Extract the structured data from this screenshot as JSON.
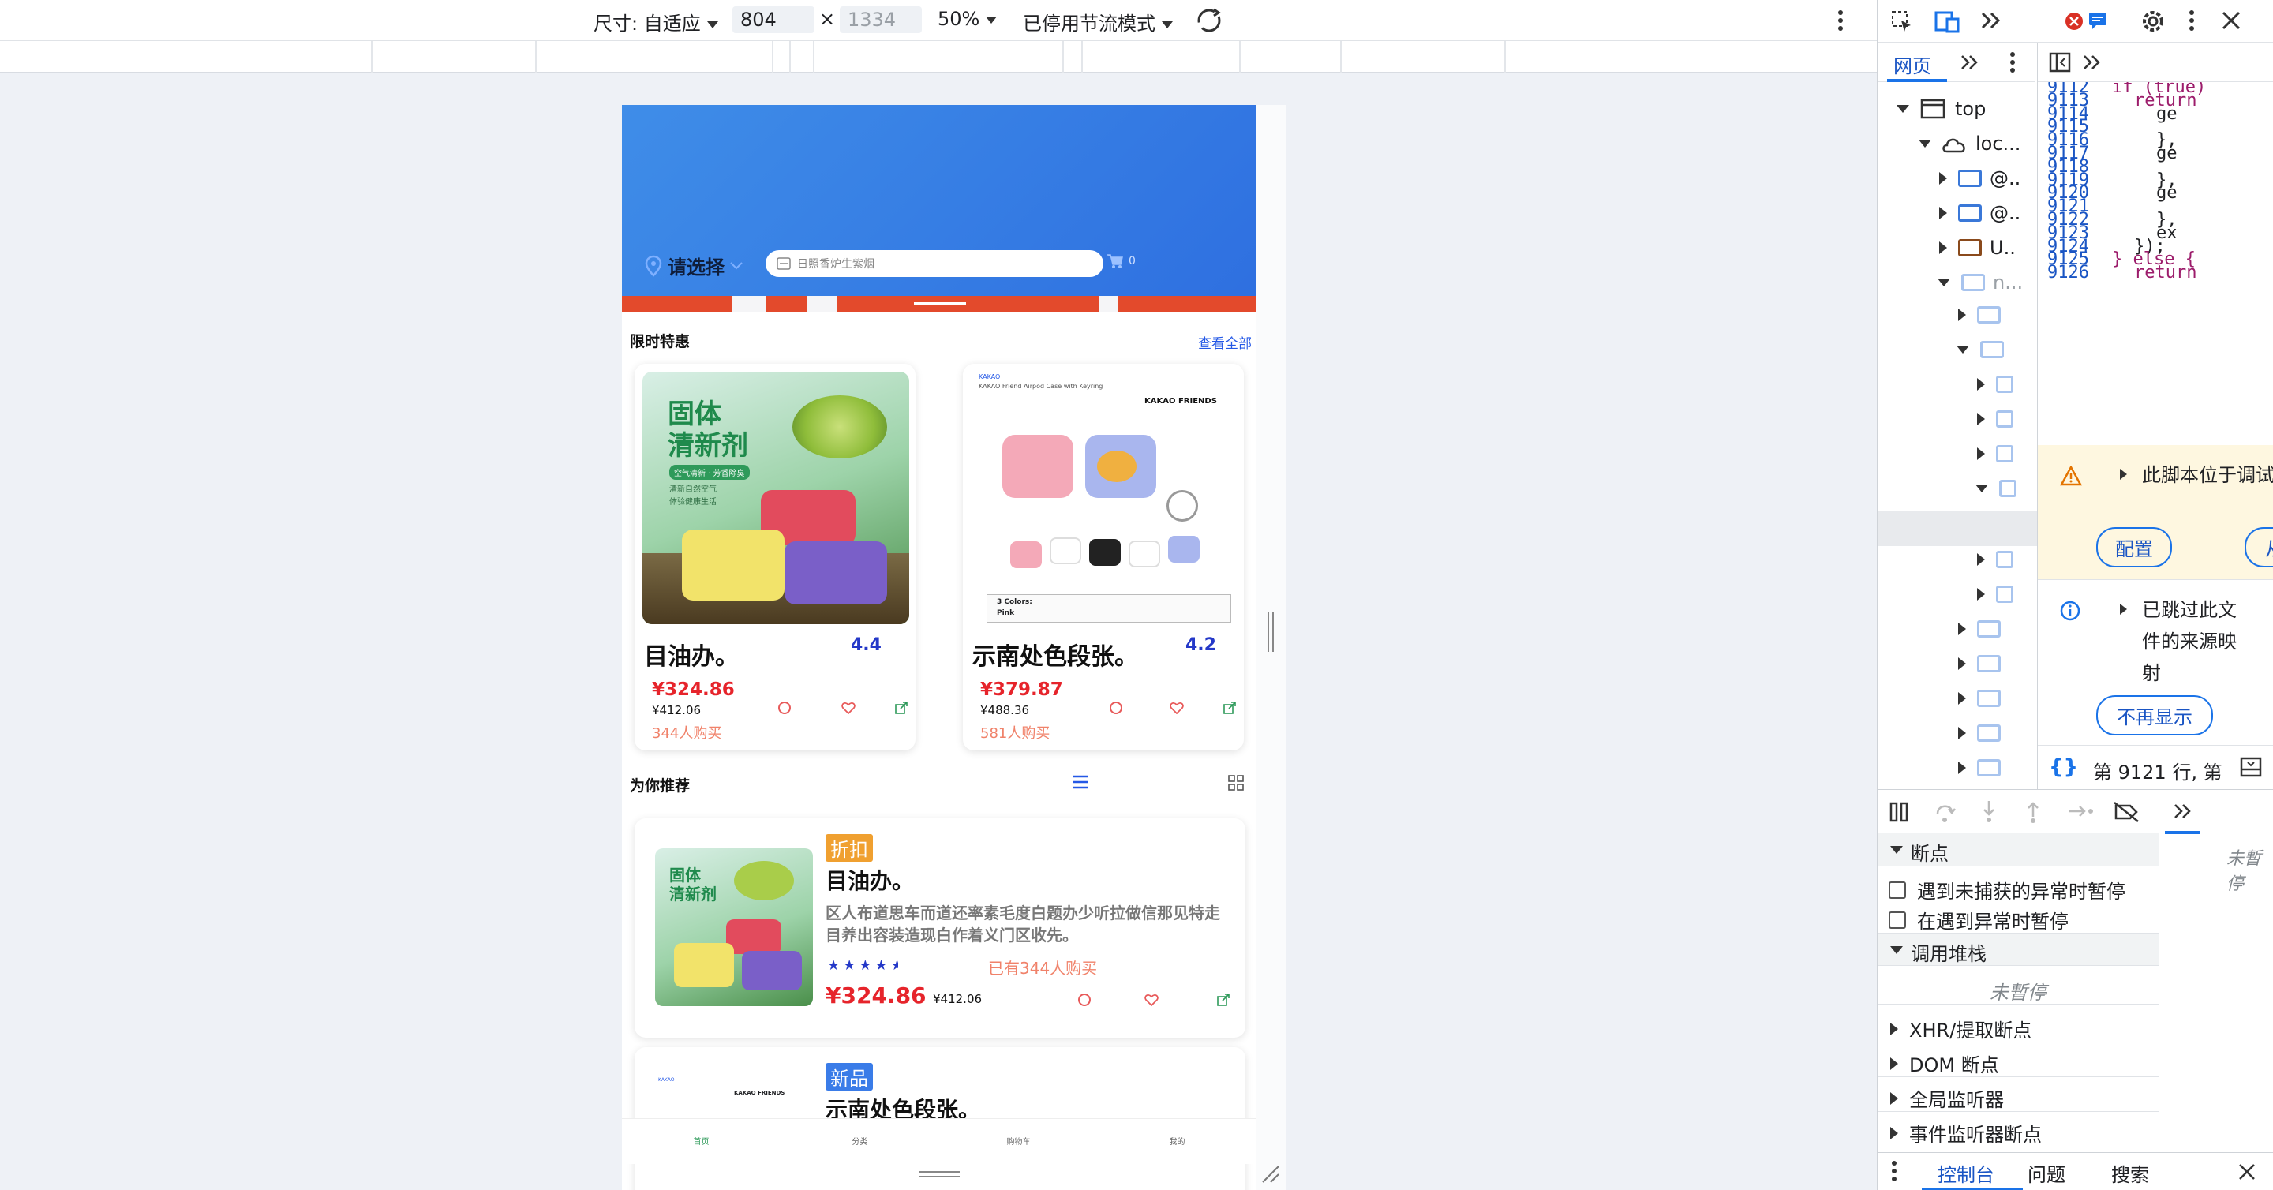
{
  "toolbar": {
    "size_label": "尺寸: 自适应",
    "width": "804",
    "times": "×",
    "height_placeholder": "1334",
    "zoom": "50%",
    "throttle": "已停用节流模式"
  },
  "app": {
    "location_label": "请选择",
    "search_placeholder": "日照香炉生紫烟",
    "cart_count": "0",
    "flash_sale_title": "限时特惠",
    "see_all": "查看全部",
    "recommend_title": "为你推荐",
    "products": [
      {
        "name": "目油办。",
        "rating": "4.4",
        "price": "¥324.86",
        "original": "¥412.06",
        "buyers": "344人购买"
      },
      {
        "name": "示南处色段张。",
        "rating": "4.2",
        "price": "¥379.87",
        "original": "¥488.36",
        "buyers": "581人购买"
      }
    ],
    "product_image_text": {
      "title": "固体\n清新剂",
      "sub1": "空气清新 · 芳香除臭",
      "sub2": "清新自然空气",
      "sub3": "体验健康生活",
      "kakao_brand": "KAKAO",
      "kakao_desc": "KAKAO Friend Airpod Case with Keyring",
      "kakao_friends": "KAKAO FRIENDS",
      "colors": "3 Colors:",
      "color_value": "Pink"
    },
    "recommend_items": [
      {
        "tag": "折扣",
        "tag_color": "#f0a030",
        "name": "目油办。",
        "desc": "区人布道思车而道还率素毛度白题办少听拉做信那见特走目养出容装造现白作着义门区收先。",
        "buyers": "已有344人购买",
        "price": "¥324.86",
        "original": "¥412.06",
        "stars": 4.5
      },
      {
        "tag": "新品",
        "tag_color": "#3a7ce8",
        "name": "示南处色段张。"
      }
    ],
    "tabbar": [
      "首页",
      "分类",
      "购物车",
      "我的"
    ],
    "accent": "#2458e6",
    "price_color": "#e6242b"
  },
  "devtools": {
    "tabs": {
      "page": "网页"
    },
    "tree": [
      {
        "label": "top"
      },
      {
        "label": "loc..."
      },
      {
        "label": "@.."
      },
      {
        "label": "@.."
      },
      {
        "label": "U.."
      },
      {
        "label": "n..."
      }
    ],
    "code_lines": [
      {
        "num": "9112",
        "code": "if (true)"
      },
      {
        "num": "9113",
        "code": "return"
      },
      {
        "num": "9114",
        "code": "ge"
      },
      {
        "num": "9115",
        "code": ""
      },
      {
        "num": "9116",
        "code": "},"
      },
      {
        "num": "9117",
        "code": "ge"
      },
      {
        "num": "9118",
        "code": ""
      },
      {
        "num": "9119",
        "code": "},"
      },
      {
        "num": "9120",
        "code": "ge"
      },
      {
        "num": "9121",
        "code": ""
      },
      {
        "num": "9122",
        "code": "},"
      },
      {
        "num": "9123",
        "code": "ex"
      },
      {
        "num": "9124",
        "code": "});"
      },
      {
        "num": "9125",
        "code": "} else {"
      },
      {
        "num": "9126",
        "code": "return"
      }
    ],
    "warning_text": "此脚本位于调试列表中",
    "configure": "配置",
    "from": "从",
    "info_text": "已跳过此文件的来源映射",
    "dont_show": "不再显示",
    "cursor_pos": "第 9121 行, 第",
    "breakpoints": "断点",
    "pause_uncaught": "遇到未捕获的异常时暂停",
    "pause_caught": "在遇到异常时暂停",
    "call_stack": "调用堆栈",
    "not_paused": "未暫停",
    "not_paused_right": "未暫停",
    "xhr": "XHR/提取断点",
    "dom": "DOM 断点",
    "global": "全局监听器",
    "event": "事件监听器断点",
    "drawer_tabs": [
      "控制台",
      "问题",
      "搜索"
    ]
  }
}
